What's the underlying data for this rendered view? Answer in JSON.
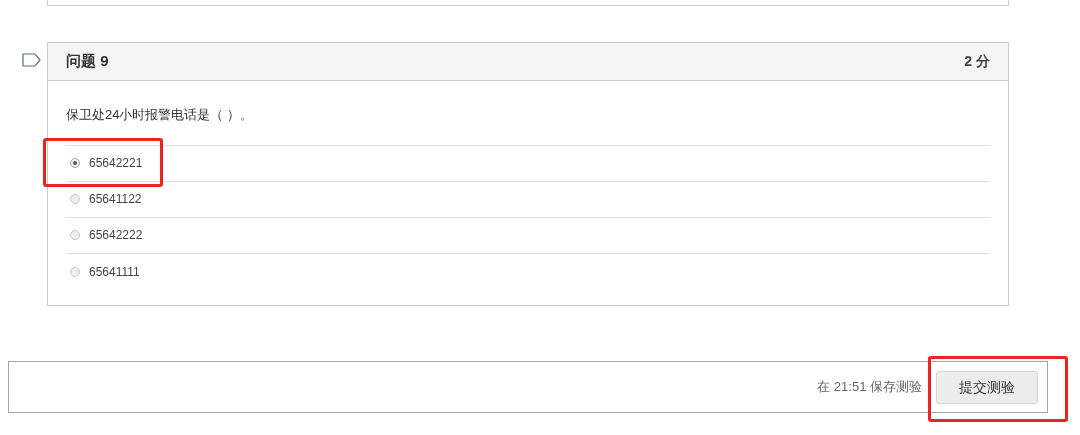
{
  "question": {
    "title": "问题 9",
    "points": "2 分",
    "flagged": false,
    "prompt": "保卫处24小时报警电话是（ ）。",
    "options": [
      {
        "label": "65642221",
        "selected": true
      },
      {
        "label": "65641122",
        "selected": false
      },
      {
        "label": "65642222",
        "selected": false
      },
      {
        "label": "65641111",
        "selected": false
      }
    ]
  },
  "footer": {
    "saved_status": "在 21:51 保存测验",
    "submit_button": "提交测验"
  }
}
